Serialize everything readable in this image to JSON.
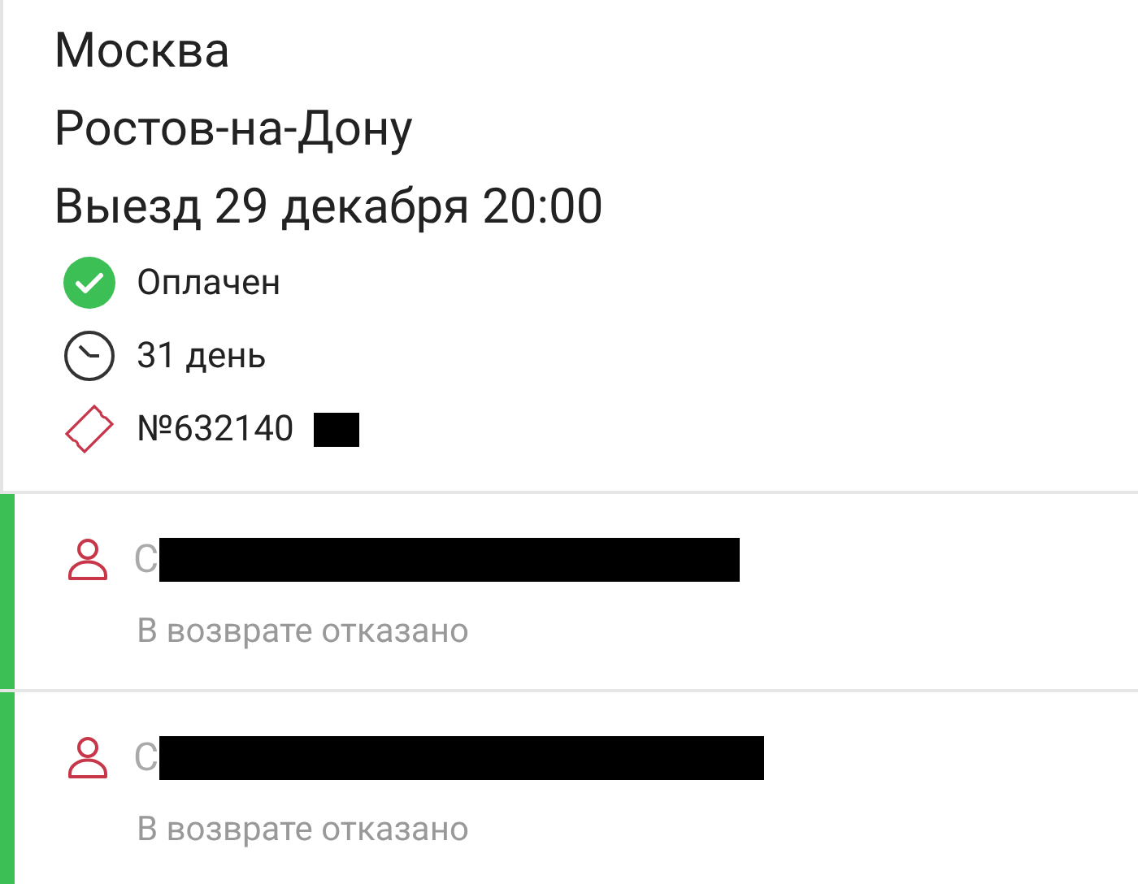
{
  "trip": {
    "from": "Москва",
    "to": "Ростов-на-Дону",
    "departure": "Выезд 29 декабря 20:00"
  },
  "details": [
    {
      "kind": "paid",
      "text": "Оплачен"
    },
    {
      "kind": "duration",
      "text": "31 день"
    },
    {
      "kind": "ticket",
      "text": "№632140"
    }
  ],
  "passengers": [
    {
      "name": "С",
      "status": "В возврате отказано"
    },
    {
      "name": "С",
      "status": "В возврате отказано"
    }
  ]
}
